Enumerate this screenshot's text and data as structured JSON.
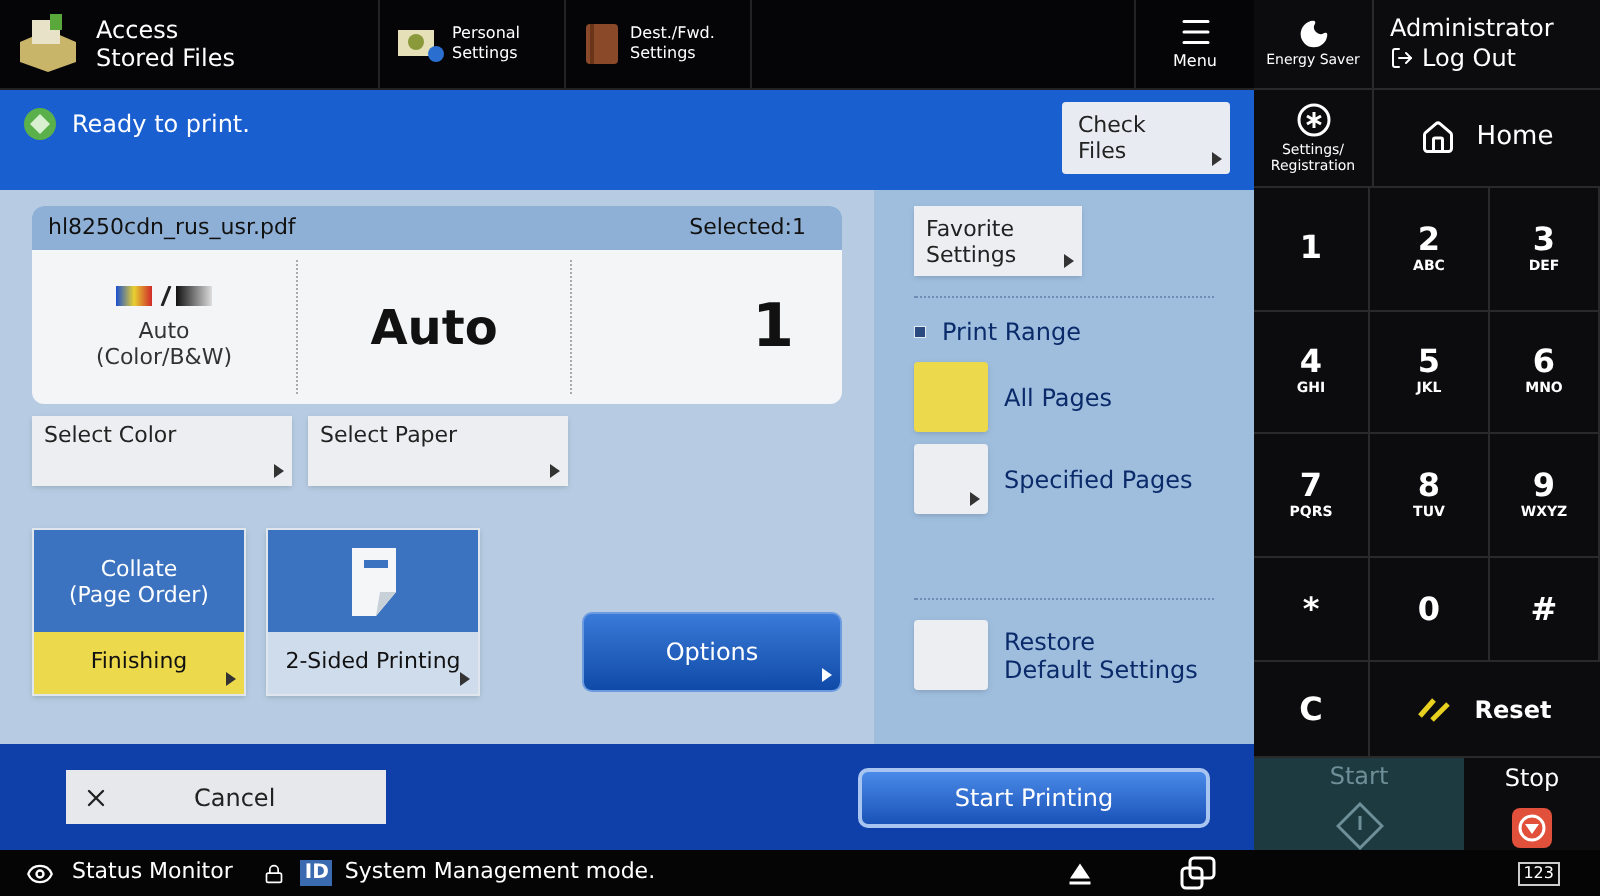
{
  "top_bar": {
    "title": "Access\nStored Files",
    "items": [
      {
        "kind": "personal",
        "label": "Personal\nSettings"
      },
      {
        "kind": "book",
        "label": "Dest./Fwd.\nSettings"
      }
    ],
    "menu": "Menu"
  },
  "status_bar_top": {
    "message": "Ready to print.",
    "button": "Check\nFiles"
  },
  "file_panel": {
    "filename": "hl8250cdn_rus_usr.pdf",
    "selected": "Selected:1",
    "color_mode": "Auto\n(Color/B&W)",
    "paper": "Auto",
    "copies": "1"
  },
  "select_buttons": [
    "Select Color",
    "Select Paper"
  ],
  "tiles": [
    {
      "kind": "text",
      "text": "Collate\n(Page Order)",
      "caption": "Finishing",
      "selected": true
    },
    {
      "kind": "icon",
      "caption": "2-Sided Printing",
      "selected": false
    }
  ],
  "options": "Options",
  "side": {
    "favorite": "Favorite\nSettings",
    "print_range": "Print Range",
    "ranges": [
      {
        "label": "All Pages",
        "selected": true,
        "caret": false
      },
      {
        "label": "Specified Pages",
        "selected": false,
        "caret": true
      }
    ],
    "restore": "Restore\nDefault Settings"
  },
  "cancel": "Cancel",
  "start_printing": "Start Printing",
  "right_panel": {
    "energy_saver": "Energy Saver",
    "user": "Administrator",
    "log_out": "Log Out",
    "settings": "Settings/\nRegistration",
    "home": "Home",
    "keys": [
      {
        "main": "1"
      },
      {
        "main": "2",
        "sub": "ABC"
      },
      {
        "main": "3",
        "sub": "DEF"
      },
      {
        "main": "4",
        "sub": "GHI"
      },
      {
        "main": "5",
        "sub": "JKL"
      },
      {
        "main": "6",
        "sub": "MNO"
      },
      {
        "main": "7",
        "sub": "PQRS"
      },
      {
        "main": "8",
        "sub": "TUV"
      },
      {
        "main": "9",
        "sub": "WXYZ"
      },
      {
        "main": "*"
      },
      {
        "main": "0"
      },
      {
        "main": "#"
      }
    ],
    "clear": "C",
    "reset": "Reset",
    "start": "Start",
    "start_disabled": true,
    "stop": "Stop"
  },
  "footer": {
    "status_monitor": "Status Monitor",
    "id_badge": "ID",
    "mode": "System Management mode.",
    "keypad_badge": "123"
  }
}
